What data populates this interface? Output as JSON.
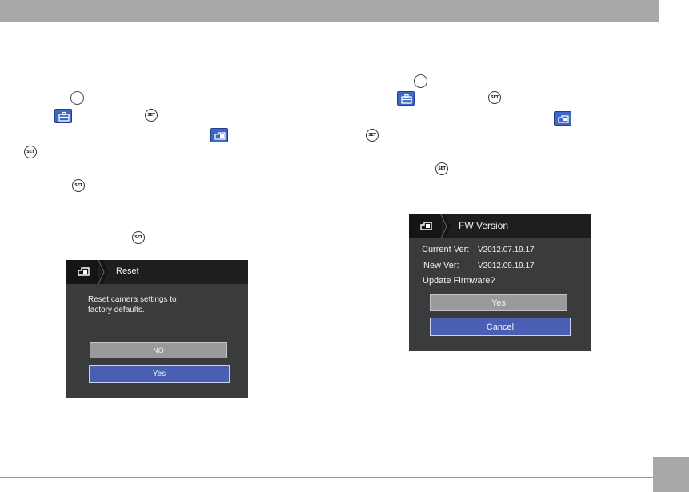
{
  "colors": {
    "bar_gray": "#a8a8aa",
    "icon_blue": "#3f67c6",
    "dialog_bg": "#3a3b3d",
    "button_blue": "#4a5fb4",
    "button_gray": "#9a9a9c"
  },
  "icons": {
    "set_button_label": "SET",
    "mode_button": "round-mode-button-icon",
    "setup_menu": "toolbox-setup-icon",
    "device_settings": "camera-settings-icon"
  },
  "reset_dialog": {
    "title": "Reset",
    "message_line1": "Reset camera settings to",
    "message_line2": "factory defaults.",
    "no_label": "NO",
    "yes_label": "Yes"
  },
  "fw_dialog": {
    "title": "FW Version",
    "current_label": "Current Ver:",
    "current_value": "V2012.07.19.17",
    "new_label": "New Ver:",
    "new_value": "V2012.09.19.17",
    "prompt": "Update Firmware?",
    "yes_label": "Yes",
    "cancel_label": "Cancel"
  }
}
